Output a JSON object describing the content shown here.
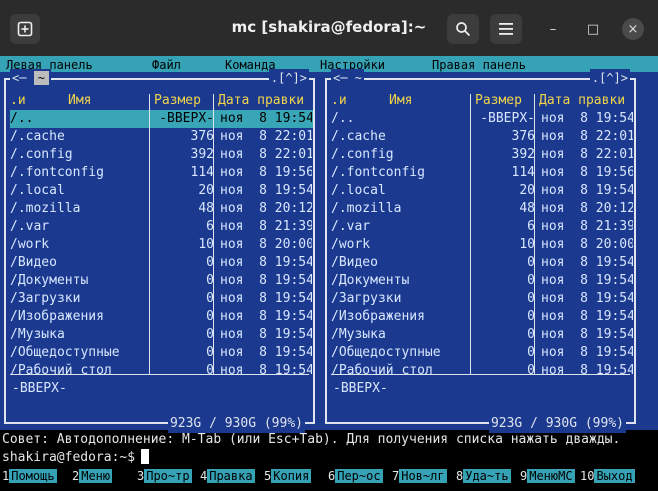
{
  "window": {
    "title": "mc [shakira@fedora]:~",
    "new_tab_icon": "plus-square-icon",
    "search_icon": "search-icon",
    "menu_icon": "hamburger-icon",
    "minimize": "–",
    "maximize": "□",
    "close": "×"
  },
  "menubar": [
    "Левая панель",
    "Файл",
    "Команда",
    "Настройки",
    "Правая панель"
  ],
  "left_panel": {
    "path": "~",
    "corner": ".[^]>",
    "arrow_left": "<─",
    "headers": [
      ".и",
      "Имя",
      "Размер",
      "Дата правки"
    ],
    "rows": [
      {
        "name": "/..",
        "size": "-ВВЕРХ-",
        "date": "ноя  8 19:54"
      },
      {
        "name": "/.cache",
        "size": "376",
        "date": "ноя  8 22:01"
      },
      {
        "name": "/.config",
        "size": "392",
        "date": "ноя  8 22:01"
      },
      {
        "name": "/.fontconfig",
        "size": "114",
        "date": "ноя  8 19:56"
      },
      {
        "name": "/.local",
        "size": "20",
        "date": "ноя  8 19:54"
      },
      {
        "name": "/.mozilla",
        "size": "48",
        "date": "ноя  8 20:12"
      },
      {
        "name": "/.var",
        "size": "6",
        "date": "ноя  8 21:39"
      },
      {
        "name": "/work",
        "size": "10",
        "date": "ноя  8 20:00"
      },
      {
        "name": "/Видео",
        "size": "0",
        "date": "ноя  8 19:54"
      },
      {
        "name": "/Документы",
        "size": "0",
        "date": "ноя  8 19:54"
      },
      {
        "name": "/Загрузки",
        "size": "0",
        "date": "ноя  8 19:54"
      },
      {
        "name": "/Изображения",
        "size": "0",
        "date": "ноя  8 19:54"
      },
      {
        "name": "/Музыка",
        "size": "0",
        "date": "ноя  8 19:54"
      },
      {
        "name": "/Общедоступные",
        "size": "0",
        "date": "ноя  8 19:54"
      },
      {
        "name": "/Рабочий стол",
        "size": "0",
        "date": "ноя  8 19:54"
      }
    ],
    "mini_status": "-ВВЕРХ-",
    "disk": "923G / 930G (99%)"
  },
  "right_panel": {
    "path": "~",
    "corner": ".[^]>",
    "arrow_left": "<─",
    "headers": [
      ".и",
      "Имя",
      "Размер",
      "Дата правки"
    ],
    "rows": [
      {
        "name": "/..",
        "size": "-ВВЕРХ-",
        "date": "ноя  8 19:54"
      },
      {
        "name": "/.cache",
        "size": "376",
        "date": "ноя  8 22:01"
      },
      {
        "name": "/.config",
        "size": "392",
        "date": "ноя  8 22:01"
      },
      {
        "name": "/.fontconfig",
        "size": "114",
        "date": "ноя  8 19:56"
      },
      {
        "name": "/.local",
        "size": "20",
        "date": "ноя  8 19:54"
      },
      {
        "name": "/.mozilla",
        "size": "48",
        "date": "ноя  8 20:12"
      },
      {
        "name": "/.var",
        "size": "6",
        "date": "ноя  8 21:39"
      },
      {
        "name": "/work",
        "size": "10",
        "date": "ноя  8 20:00"
      },
      {
        "name": "/Видео",
        "size": "0",
        "date": "ноя  8 19:54"
      },
      {
        "name": "/Документы",
        "size": "0",
        "date": "ноя  8 19:54"
      },
      {
        "name": "/Загрузки",
        "size": "0",
        "date": "ноя  8 19:54"
      },
      {
        "name": "/Изображения",
        "size": "0",
        "date": "ноя  8 19:54"
      },
      {
        "name": "/Музыка",
        "size": "0",
        "date": "ноя  8 19:54"
      },
      {
        "name": "/Общедоступные",
        "size": "0",
        "date": "ноя  8 19:54"
      },
      {
        "name": "/Рабочий стол",
        "size": "0",
        "date": "ноя  8 19:54"
      }
    ],
    "mini_status": "-ВВЕРХ-",
    "disk": "923G / 930G (99%)"
  },
  "hint": "Совет: Автодополнение: M-Tab (или Esc+Tab). Для получения списка нажать дважды.",
  "prompt": "shakira@fedora:~$",
  "fkeys": [
    {
      "num": "1",
      "label": "Помощь"
    },
    {
      "num": "2",
      "label": "Меню"
    },
    {
      "num": "3",
      "label": "Про~тр"
    },
    {
      "num": "4",
      "label": "Правка"
    },
    {
      "num": "5",
      "label": "Копия"
    },
    {
      "num": "6",
      "label": "Пер~ос"
    },
    {
      "num": "7",
      "label": "Нов~лг"
    },
    {
      "num": "8",
      "label": "Уда~ть"
    },
    {
      "num": "9",
      "label": "МенюMC"
    },
    {
      "num": "10",
      "label": "Выход"
    }
  ]
}
